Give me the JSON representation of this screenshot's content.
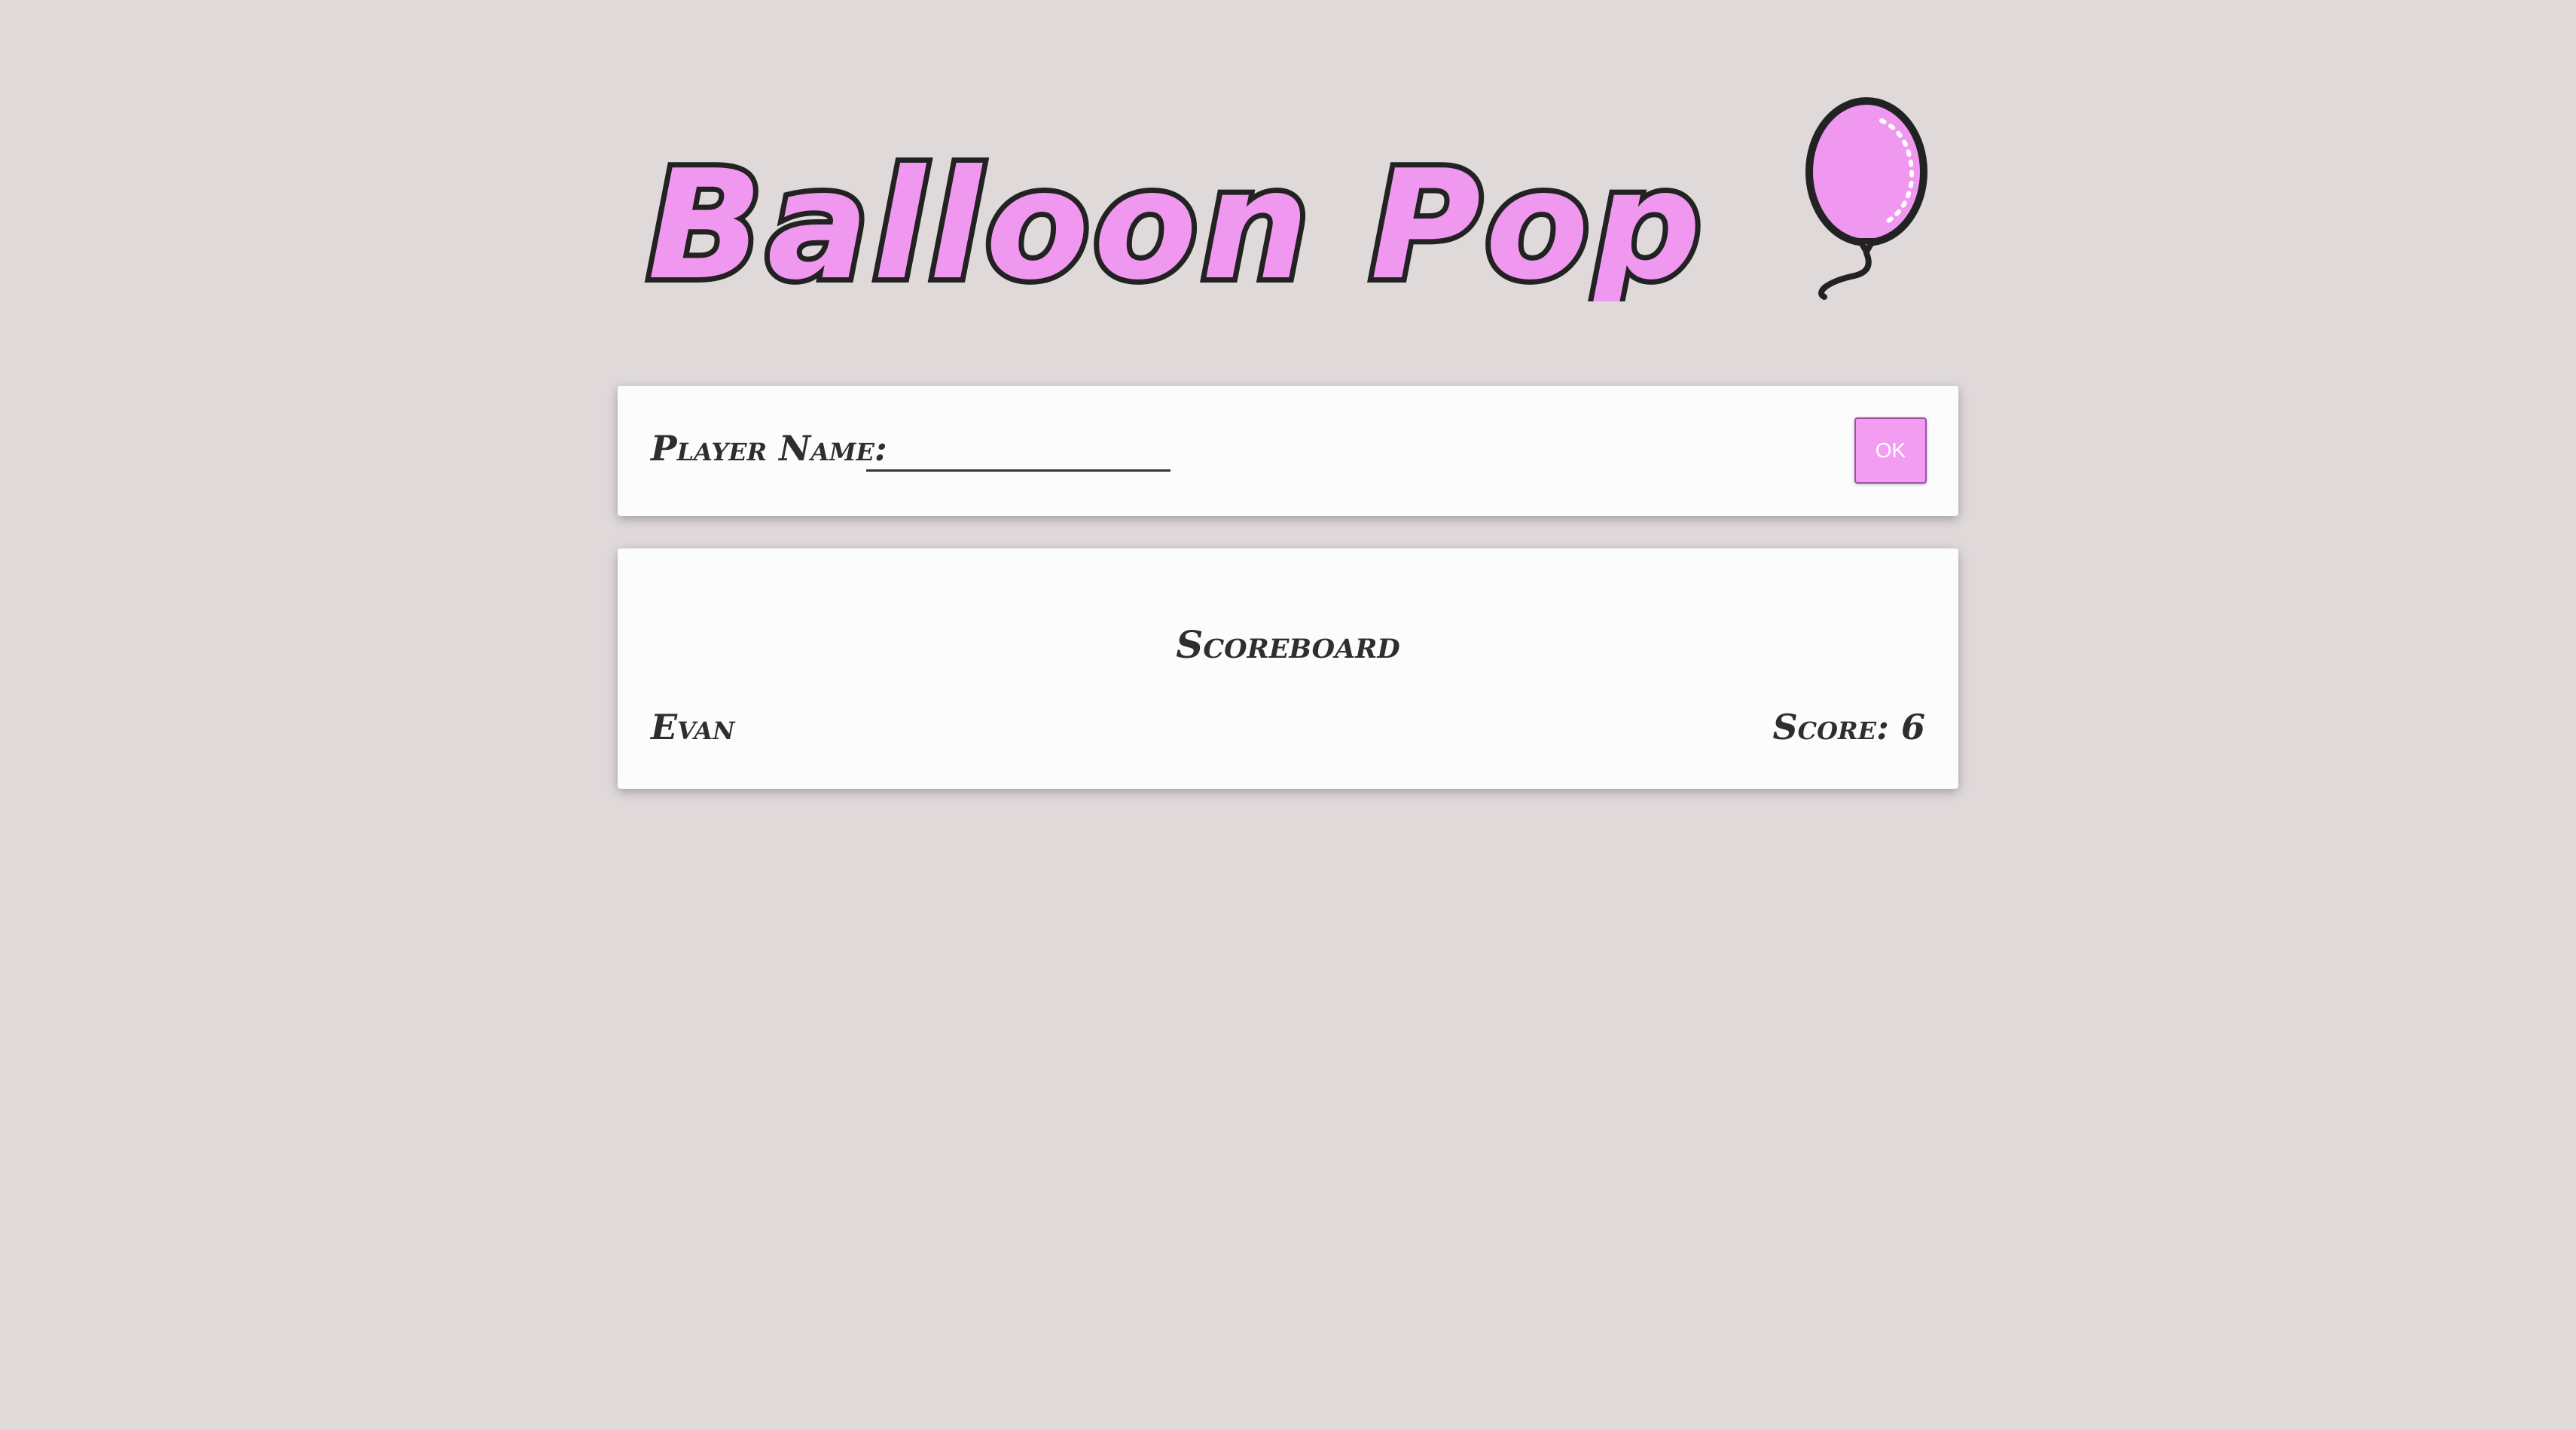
{
  "header": {
    "title": "Balloon Pop",
    "logo_icon": "balloon-icon",
    "colors": {
      "balloon_fill": "#f097f0",
      "outline": "#222222",
      "background": "#dfd9da"
    }
  },
  "player_form": {
    "label": "Player Name:",
    "name_value": "",
    "ok_label": "OK",
    "ok_color": "#f29df2"
  },
  "scoreboard": {
    "title": "Scoreboard",
    "entries": [
      {
        "name": "Evan",
        "score_text": "Score: 6"
      }
    ]
  }
}
